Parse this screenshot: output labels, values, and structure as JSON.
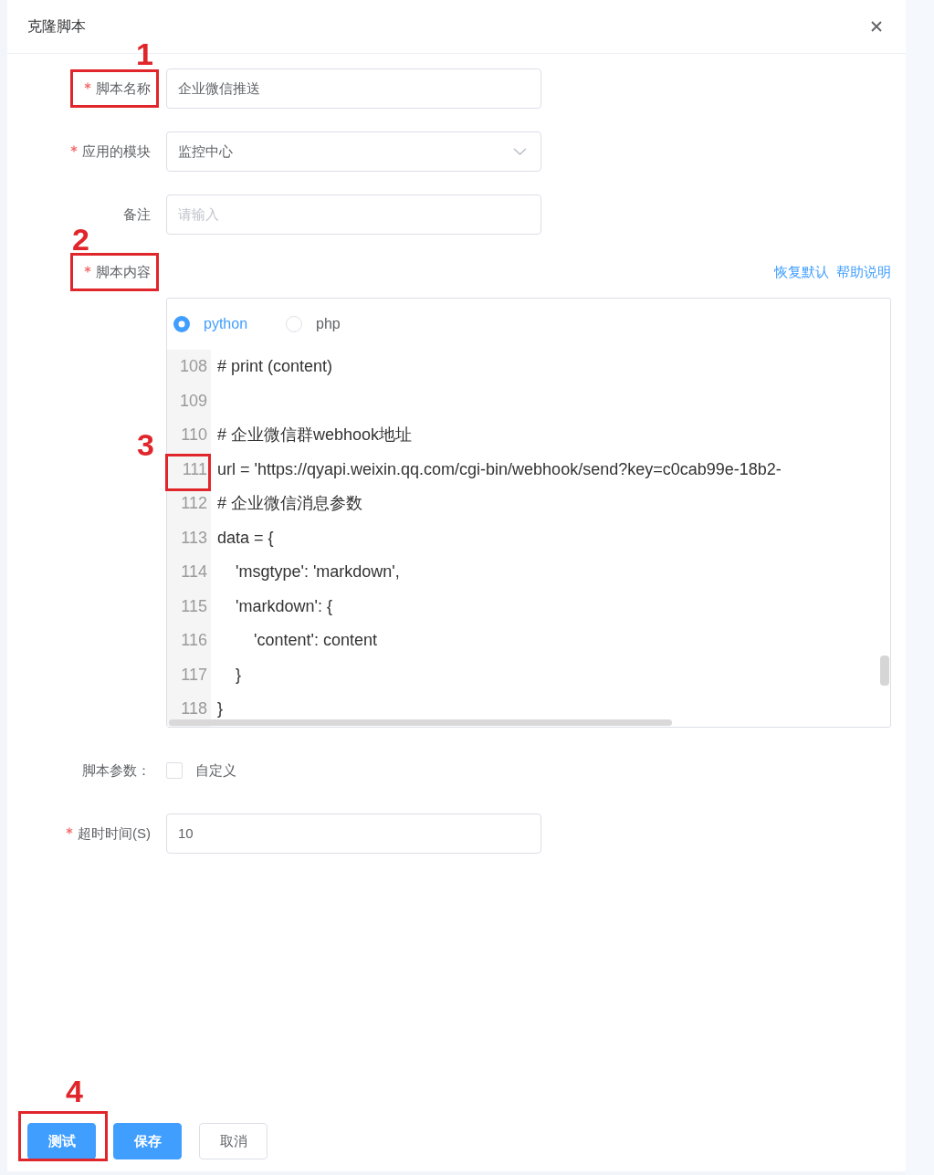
{
  "dialog": {
    "title": "克隆脚本"
  },
  "fields": [
    {
      "kind": "input",
      "label": "脚本名称",
      "required": true,
      "annotation": "1",
      "value": "企业微信推送"
    },
    {
      "kind": "select",
      "label": "应用的模块",
      "required": true,
      "value": "监控中心"
    },
    {
      "kind": "input",
      "label": "备注",
      "required": false,
      "placeholder": "请输入"
    }
  ],
  "script": {
    "label": "脚本内容",
    "required": true,
    "annotation": "2",
    "links": [
      "恢复默认",
      "帮助说明"
    ],
    "languages": [
      {
        "label": "python",
        "selected": true
      },
      {
        "label": "php",
        "selected": false
      }
    ],
    "lines": [
      {
        "number": "108",
        "code": "# print (content)"
      },
      {
        "number": "109"
      },
      {
        "number": "110",
        "code": "# 企业微信群webhook地址"
      },
      {
        "number": "111",
        "code": "url = 'https://qyapi.weixin.qq.com/cgi-bin/webhook/send?key=c0cab99e-18b2-",
        "annotation": "3"
      },
      {
        "number": "112",
        "code": "# 企业微信消息参数"
      },
      {
        "number": "113",
        "code": "data = {"
      },
      {
        "number": "114",
        "code": "    'msgtype': 'markdown',"
      },
      {
        "number": "115",
        "code": "    'markdown': {"
      },
      {
        "number": "116",
        "code": "        'content': content"
      },
      {
        "number": "117",
        "code": "    }"
      },
      {
        "number": "118",
        "code": "}"
      }
    ]
  },
  "params": {
    "label": "脚本参数：",
    "checkbox": {
      "label": "自定义",
      "checked": false
    }
  },
  "timeout": {
    "label": "超时时间(S)",
    "required": true,
    "value": "10"
  },
  "buttons": [
    {
      "label": "测试",
      "kind": "primary",
      "annotation": "4"
    },
    {
      "label": "保存",
      "kind": "primary"
    },
    {
      "label": "取消",
      "kind": "default"
    }
  ]
}
